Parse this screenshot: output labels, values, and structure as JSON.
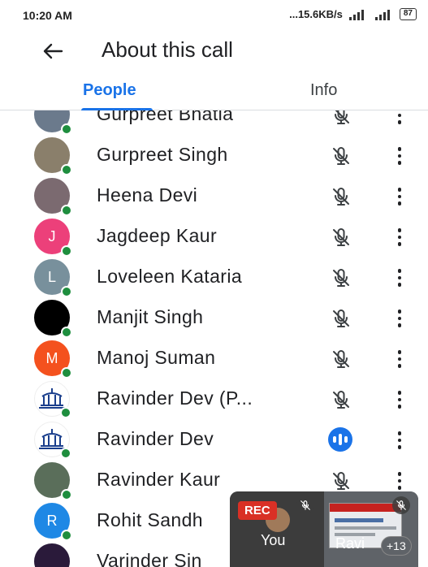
{
  "status_bar": {
    "time": "10:20 AM",
    "speed": "...15.6KB/s",
    "battery": "87"
  },
  "header": {
    "title": "About this call"
  },
  "tabs": [
    {
      "label": "People",
      "active": true
    },
    {
      "label": "Info",
      "active": false
    }
  ],
  "participants": [
    {
      "name": "Gurpreet Bhatia",
      "avatar": "photo-icon",
      "avatar_color": "#6b7a8c",
      "initial": "",
      "status": "muted"
    },
    {
      "name": "Gurpreet Singh",
      "avatar": "photo-icon",
      "avatar_color": "#8a7f6b",
      "initial": "",
      "status": "muted"
    },
    {
      "name": "Heena Devi",
      "avatar": "photo-icon",
      "avatar_color": "#7b6a70",
      "initial": "",
      "status": "muted"
    },
    {
      "name": "Jagdeep Kaur",
      "avatar": "initial",
      "avatar_color": "#ec407a",
      "initial": "J",
      "status": "muted"
    },
    {
      "name": "Loveleen Kataria",
      "avatar": "initial",
      "avatar_color": "#78909c",
      "initial": "L",
      "status": "muted"
    },
    {
      "name": "Manjit Singh",
      "avatar": "photo-icon",
      "avatar_color": "#000000",
      "initial": "",
      "status": "muted"
    },
    {
      "name": "Manoj Suman",
      "avatar": "initial",
      "avatar_color": "#f4511e",
      "initial": "M",
      "status": "muted"
    },
    {
      "name": "Ravinder Dev (P...",
      "avatar": "logo-icon",
      "avatar_color": "#ffffff",
      "initial": "",
      "status": "muted"
    },
    {
      "name": "Ravinder Dev",
      "avatar": "logo-icon",
      "avatar_color": "#ffffff",
      "initial": "",
      "status": "speaking"
    },
    {
      "name": "Ravinder Kaur",
      "avatar": "photo-icon",
      "avatar_color": "#5a6e5a",
      "initial": "",
      "status": "muted"
    },
    {
      "name": "Rohit Sandh",
      "avatar": "initial",
      "avatar_color": "#1e88e5",
      "initial": "R",
      "status": "muted"
    },
    {
      "name": "Varinder Sin",
      "avatar": "photo-icon",
      "avatar_color": "#2a1a3a",
      "initial": "",
      "status": "muted"
    }
  ],
  "self_view": {
    "rec_label": "REC",
    "self_label": "You",
    "other_label": "Ravi",
    "more_count": "+13"
  },
  "colors": {
    "accent": "#1a73e8",
    "online_dot": "#1e8e3e",
    "rec": "#d93025"
  }
}
